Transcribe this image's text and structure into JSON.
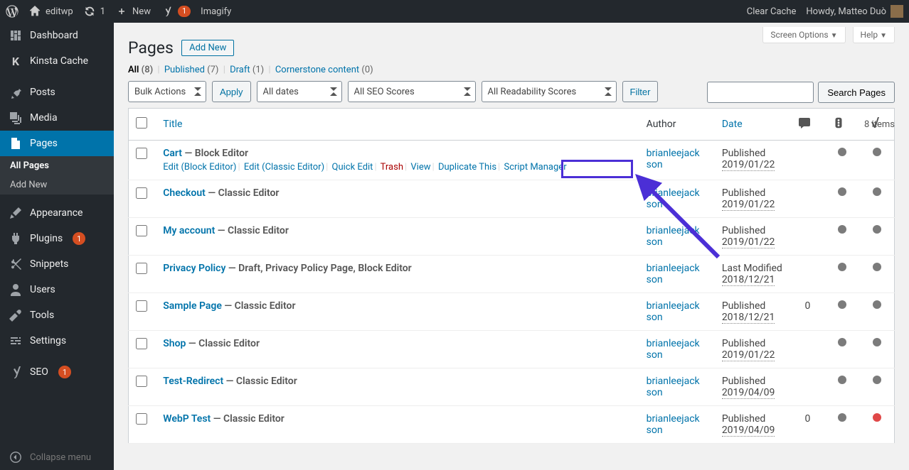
{
  "adminbar": {
    "site": "editwp",
    "updates": "1",
    "new": "New",
    "imagify": "Imagify",
    "yoast_badge": "1",
    "clearcache": "Clear Cache",
    "howdy": "Howdy, Matteo Duò"
  },
  "sidebar": {
    "dashboard": "Dashboard",
    "kinsta": "Kinsta Cache",
    "posts": "Posts",
    "media": "Media",
    "pages": "Pages",
    "all_pages": "All Pages",
    "add_new": "Add New",
    "appearance": "Appearance",
    "plugins": "Plugins",
    "plugins_count": "1",
    "snippets": "Snippets",
    "users": "Users",
    "tools": "Tools",
    "settings": "Settings",
    "seo": "SEO",
    "seo_count": "1",
    "collapse": "Collapse menu"
  },
  "header": {
    "title": "Pages",
    "add_new": "Add New"
  },
  "tabs": {
    "screen_options": "Screen Options",
    "help": "Help"
  },
  "subsubsub": {
    "all": "All",
    "all_count": "(8)",
    "published": "Published",
    "published_count": "(7)",
    "draft": "Draft",
    "draft_count": "(1)",
    "cornerstone": "Cornerstone content",
    "cornerstone_count": "(0)"
  },
  "filters": {
    "bulk_actions": "Bulk Actions",
    "apply": "Apply",
    "all_dates": "All dates",
    "all_seo": "All SEO Scores",
    "all_readability": "All Readability Scores",
    "filter": "Filter",
    "items": "8 items"
  },
  "search": {
    "button": "Search Pages"
  },
  "columns": {
    "title": "Title",
    "author": "Author",
    "date": "Date",
    "comments": "0"
  },
  "row_actions": {
    "edit_block": "Edit (Block Editor)",
    "edit_classic": "Edit (Classic Editor)",
    "quick_edit": "Quick Edit",
    "trash": "Trash",
    "view": "View",
    "duplicate": "Duplicate This",
    "script_mgr": "Script Manager"
  },
  "rows": [
    {
      "title": "Cart",
      "state": "Block Editor",
      "author": "brianleejackson",
      "status": "Published",
      "date": "2019/01/22",
      "comments": "",
      "seo": "grey",
      "read": "grey",
      "show_actions": true
    },
    {
      "title": "Checkout",
      "state": "Classic Editor",
      "author": "brianleejackson",
      "status": "Published",
      "date": "2019/01/22",
      "comments": "",
      "seo": "grey",
      "read": "grey"
    },
    {
      "title": "My account",
      "state": "Classic Editor",
      "author": "brianleejackson",
      "status": "Published",
      "date": "2019/01/22",
      "comments": "",
      "seo": "grey",
      "read": "grey"
    },
    {
      "title": "Privacy Policy",
      "state": "Draft, Privacy Policy Page, Block Editor",
      "author": "brianleejackson",
      "status": "Last Modified",
      "date": "2018/12/21",
      "comments": "",
      "seo": "grey",
      "read": "grey"
    },
    {
      "title": "Sample Page",
      "state": "Classic Editor",
      "author": "brianleejackson",
      "status": "Published",
      "date": "2018/12/21",
      "comments": "0",
      "seo": "grey",
      "read": "grey"
    },
    {
      "title": "Shop",
      "state": "Classic Editor",
      "author": "brianleejackson",
      "status": "Published",
      "date": "2019/01/22",
      "comments": "",
      "seo": "grey",
      "read": "grey"
    },
    {
      "title": "Test-Redirect",
      "state": "Classic Editor",
      "author": "brianleejackson",
      "status": "Published",
      "date": "2019/04/09",
      "comments": "",
      "seo": "grey",
      "read": "grey"
    },
    {
      "title": "WebP Test",
      "state": "Classic Editor",
      "author": "brianleejackson",
      "status": "Published",
      "date": "2019/04/09",
      "comments": "0",
      "seo": "grey",
      "read": "red"
    }
  ]
}
